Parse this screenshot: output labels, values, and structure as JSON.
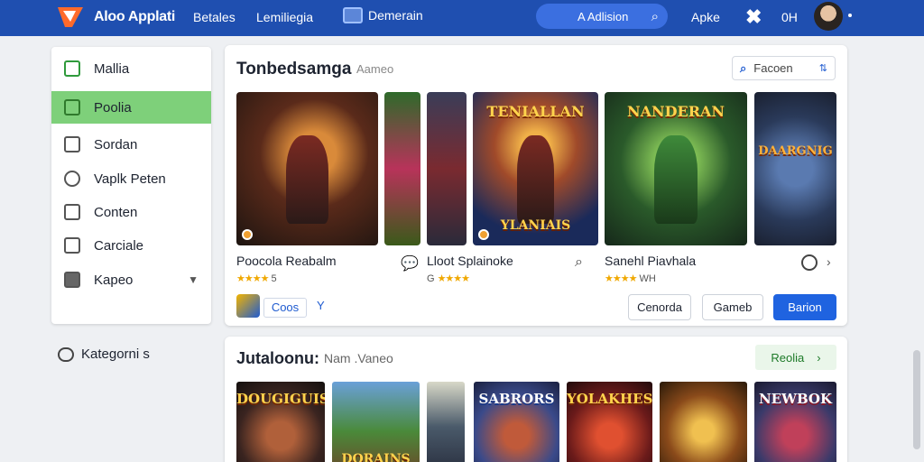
{
  "topbar": {
    "brand": "Aloo Applati",
    "nav": [
      "Betales",
      "Lemiliegia"
    ],
    "nav_button": "Demerain",
    "search_value": "A Adlision",
    "link": "Apke",
    "count": "0H",
    "colors": {
      "bar": "#1f4fb0",
      "search": "#3b6fe0"
    }
  },
  "sidebar": {
    "items": [
      {
        "label": "Mallia",
        "icon": "home-icon"
      },
      {
        "label": "Poolia",
        "icon": "grid-icon",
        "active": true
      },
      {
        "label": "Sordan",
        "icon": "calendar-icon"
      },
      {
        "label": "Vaplk Peten",
        "icon": "gamepad-icon"
      },
      {
        "label": "Conten",
        "icon": "monitor-icon"
      },
      {
        "label": "Carciale",
        "icon": "store-icon"
      },
      {
        "label": "Kapeo",
        "icon": "folder-icon"
      }
    ],
    "category": "Kategorni s"
  },
  "featured": {
    "title": "Tonbedsamga",
    "subtitle": "Aameo",
    "search_placeholder": "Facoen",
    "cards": [
      {
        "title": "",
        "sub": ""
      },
      {
        "title": "",
        "sub": ""
      },
      {
        "title": "",
        "sub": ""
      },
      {
        "title": "TENIALLAN",
        "sub": "YLANIAIS"
      },
      {
        "title": "NANDERAN",
        "sub": ""
      },
      {
        "title": "DAARGNIG",
        "sub": ""
      }
    ],
    "games": [
      {
        "name": "Poocola Reabalm",
        "stars": "★★★★",
        "rating": "5"
      },
      {
        "name": "Lloot Splainoke",
        "stars": "★★★★",
        "rating": "G"
      },
      {
        "name": "Sanehl Piavhala",
        "stars": "★★★★",
        "rating": "WH"
      }
    ],
    "footer_tag": "Coos",
    "footer_y": "Y",
    "buttons": {
      "secondary1": "Cenorda",
      "secondary2": "Gameb",
      "primary": "Barion"
    }
  },
  "categories": {
    "title": "Jutaloonu:",
    "subtitle": "Nam .Vaneo",
    "button": "Reolia",
    "tiles": [
      {
        "title": "DOUGIGUIS",
        "sub": ""
      },
      {
        "title": "",
        "sub": "DORAINS"
      },
      {
        "title": "",
        "sub": ""
      },
      {
        "title": "SABRORS",
        "sub": ""
      },
      {
        "title": "YOLAKHES",
        "sub": ""
      },
      {
        "title": "",
        "sub": ""
      },
      {
        "title": "NEWBOK",
        "sub": ""
      }
    ]
  }
}
